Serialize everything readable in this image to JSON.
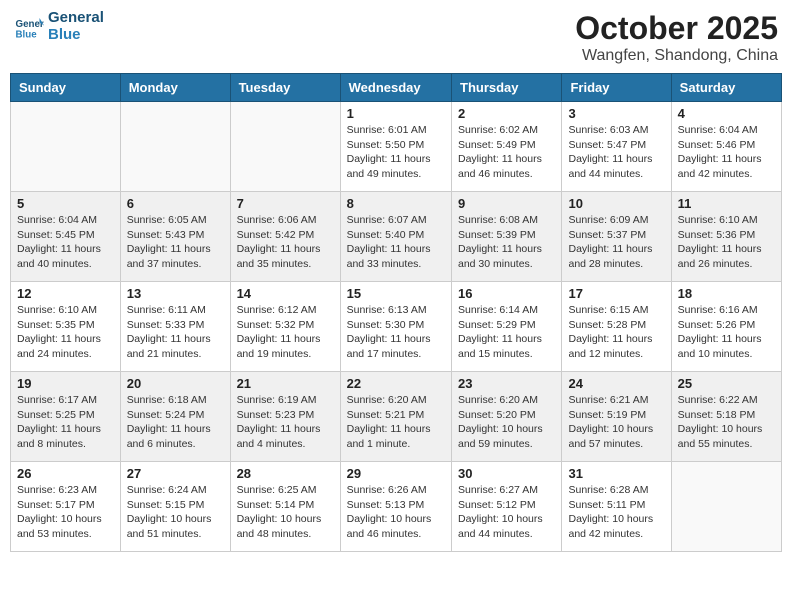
{
  "header": {
    "logo_line1": "General",
    "logo_line2": "Blue",
    "month_title": "October 2025",
    "location": "Wangfen, Shandong, China"
  },
  "weekdays": [
    "Sunday",
    "Monday",
    "Tuesday",
    "Wednesday",
    "Thursday",
    "Friday",
    "Saturday"
  ],
  "weeks": [
    [
      {
        "day": "",
        "info": ""
      },
      {
        "day": "",
        "info": ""
      },
      {
        "day": "",
        "info": ""
      },
      {
        "day": "1",
        "info": "Sunrise: 6:01 AM\nSunset: 5:50 PM\nDaylight: 11 hours\nand 49 minutes."
      },
      {
        "day": "2",
        "info": "Sunrise: 6:02 AM\nSunset: 5:49 PM\nDaylight: 11 hours\nand 46 minutes."
      },
      {
        "day": "3",
        "info": "Sunrise: 6:03 AM\nSunset: 5:47 PM\nDaylight: 11 hours\nand 44 minutes."
      },
      {
        "day": "4",
        "info": "Sunrise: 6:04 AM\nSunset: 5:46 PM\nDaylight: 11 hours\nand 42 minutes."
      }
    ],
    [
      {
        "day": "5",
        "info": "Sunrise: 6:04 AM\nSunset: 5:45 PM\nDaylight: 11 hours\nand 40 minutes."
      },
      {
        "day": "6",
        "info": "Sunrise: 6:05 AM\nSunset: 5:43 PM\nDaylight: 11 hours\nand 37 minutes."
      },
      {
        "day": "7",
        "info": "Sunrise: 6:06 AM\nSunset: 5:42 PM\nDaylight: 11 hours\nand 35 minutes."
      },
      {
        "day": "8",
        "info": "Sunrise: 6:07 AM\nSunset: 5:40 PM\nDaylight: 11 hours\nand 33 minutes."
      },
      {
        "day": "9",
        "info": "Sunrise: 6:08 AM\nSunset: 5:39 PM\nDaylight: 11 hours\nand 30 minutes."
      },
      {
        "day": "10",
        "info": "Sunrise: 6:09 AM\nSunset: 5:37 PM\nDaylight: 11 hours\nand 28 minutes."
      },
      {
        "day": "11",
        "info": "Sunrise: 6:10 AM\nSunset: 5:36 PM\nDaylight: 11 hours\nand 26 minutes."
      }
    ],
    [
      {
        "day": "12",
        "info": "Sunrise: 6:10 AM\nSunset: 5:35 PM\nDaylight: 11 hours\nand 24 minutes."
      },
      {
        "day": "13",
        "info": "Sunrise: 6:11 AM\nSunset: 5:33 PM\nDaylight: 11 hours\nand 21 minutes."
      },
      {
        "day": "14",
        "info": "Sunrise: 6:12 AM\nSunset: 5:32 PM\nDaylight: 11 hours\nand 19 minutes."
      },
      {
        "day": "15",
        "info": "Sunrise: 6:13 AM\nSunset: 5:30 PM\nDaylight: 11 hours\nand 17 minutes."
      },
      {
        "day": "16",
        "info": "Sunrise: 6:14 AM\nSunset: 5:29 PM\nDaylight: 11 hours\nand 15 minutes."
      },
      {
        "day": "17",
        "info": "Sunrise: 6:15 AM\nSunset: 5:28 PM\nDaylight: 11 hours\nand 12 minutes."
      },
      {
        "day": "18",
        "info": "Sunrise: 6:16 AM\nSunset: 5:26 PM\nDaylight: 11 hours\nand 10 minutes."
      }
    ],
    [
      {
        "day": "19",
        "info": "Sunrise: 6:17 AM\nSunset: 5:25 PM\nDaylight: 11 hours\nand 8 minutes."
      },
      {
        "day": "20",
        "info": "Sunrise: 6:18 AM\nSunset: 5:24 PM\nDaylight: 11 hours\nand 6 minutes."
      },
      {
        "day": "21",
        "info": "Sunrise: 6:19 AM\nSunset: 5:23 PM\nDaylight: 11 hours\nand 4 minutes."
      },
      {
        "day": "22",
        "info": "Sunrise: 6:20 AM\nSunset: 5:21 PM\nDaylight: 11 hours\nand 1 minute."
      },
      {
        "day": "23",
        "info": "Sunrise: 6:20 AM\nSunset: 5:20 PM\nDaylight: 10 hours\nand 59 minutes."
      },
      {
        "day": "24",
        "info": "Sunrise: 6:21 AM\nSunset: 5:19 PM\nDaylight: 10 hours\nand 57 minutes."
      },
      {
        "day": "25",
        "info": "Sunrise: 6:22 AM\nSunset: 5:18 PM\nDaylight: 10 hours\nand 55 minutes."
      }
    ],
    [
      {
        "day": "26",
        "info": "Sunrise: 6:23 AM\nSunset: 5:17 PM\nDaylight: 10 hours\nand 53 minutes."
      },
      {
        "day": "27",
        "info": "Sunrise: 6:24 AM\nSunset: 5:15 PM\nDaylight: 10 hours\nand 51 minutes."
      },
      {
        "day": "28",
        "info": "Sunrise: 6:25 AM\nSunset: 5:14 PM\nDaylight: 10 hours\nand 48 minutes."
      },
      {
        "day": "29",
        "info": "Sunrise: 6:26 AM\nSunset: 5:13 PM\nDaylight: 10 hours\nand 46 minutes."
      },
      {
        "day": "30",
        "info": "Sunrise: 6:27 AM\nSunset: 5:12 PM\nDaylight: 10 hours\nand 44 minutes."
      },
      {
        "day": "31",
        "info": "Sunrise: 6:28 AM\nSunset: 5:11 PM\nDaylight: 10 hours\nand 42 minutes."
      },
      {
        "day": "",
        "info": ""
      }
    ]
  ]
}
